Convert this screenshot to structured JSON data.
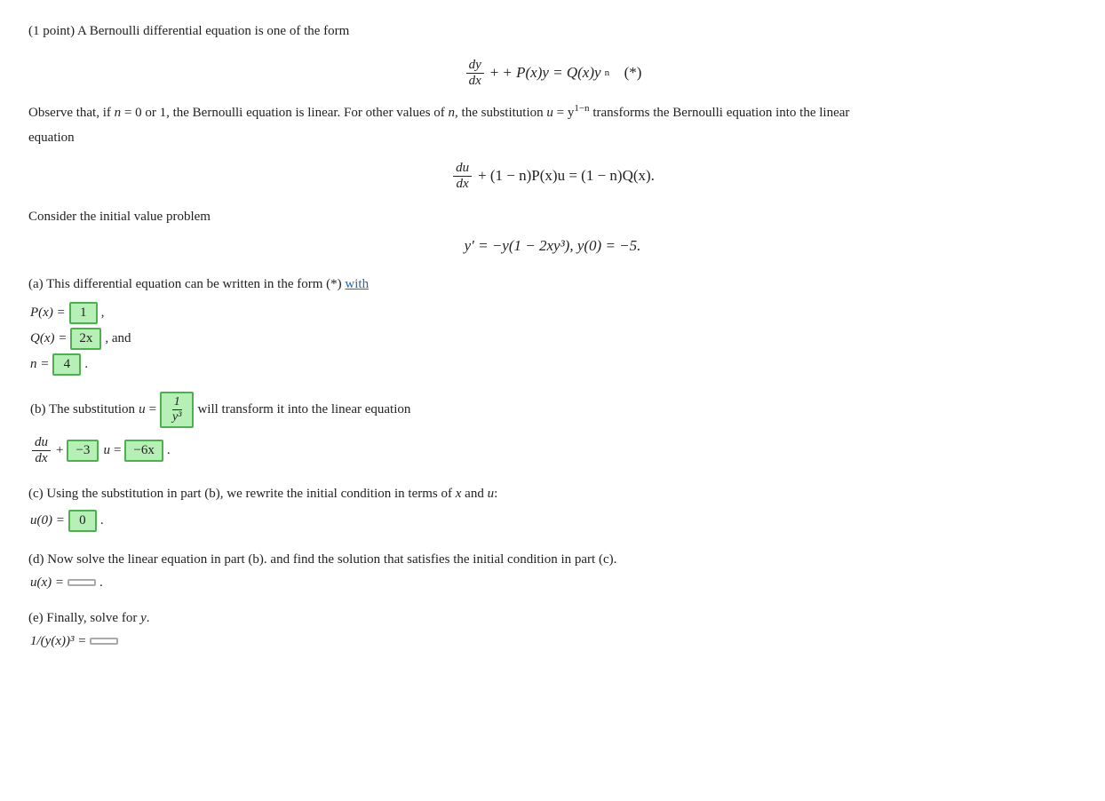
{
  "header": {
    "intro": "(1 point) A Bernoulli differential equation is one of the form"
  },
  "formula1": {
    "num": "dy",
    "den": "dx",
    "rest": "+ P(x)y = Q(x)y",
    "exp": "n",
    "star": "(*)"
  },
  "observe": {
    "text1": "Observe that, if ",
    "n": "n",
    "text2": " = 0 or 1, the Bernoulli equation is linear. For other values of ",
    "n2": "n",
    "text3": ", the substitution ",
    "u": "u",
    "text4": " = y",
    "exp": "1−n",
    "text5": " transforms the Bernoulli equation into the linear"
  },
  "observe2": "equation",
  "formula2": {
    "num": "du",
    "den": "dx",
    "rest": "+ (1 − n)P(x)u = (1 − n)Q(x)."
  },
  "consider": {
    "text": "Consider the initial value problem"
  },
  "formula3": {
    "eq": "y′ = −y(1 − 2xy³),   y(0) = −5."
  },
  "parta": {
    "label": "(a) This differential equation can be written in the form (*) ",
    "with": "with",
    "Px": "P(x) = ",
    "Px_val": "1",
    "comma1": ",",
    "Qx": "Q(x) = ",
    "Qx_val": "2x",
    "and": ", and",
    "n": "n = ",
    "n_val": "4"
  },
  "partb": {
    "label": "(b) The substitution ",
    "u": "u",
    "equals": " = ",
    "frac_num": "1",
    "frac_den": "y³",
    "rest": "will transform it into the linear equation",
    "du": "du",
    "dx": "dx",
    "plus": "+",
    "coeff1": "−3",
    "u_sym": "u",
    "equals2": " = ",
    "coeff2": "−6x",
    "period": "."
  },
  "partc": {
    "label": "(c) Using the substitution in part (b), we rewrite the initial condition in terms of ",
    "x": "x",
    "and": " and ",
    "u": "u",
    "colon": ":",
    "u0": "u(0) = ",
    "u0_val": "0",
    "period": "."
  },
  "partd": {
    "label1": "(d) Now solve the linear equation in part (b).",
    "label2": "and find the solution that satisfies the initial condition in part (c).",
    "ux": "u(x) = ",
    "ux_val": "",
    "period": "."
  },
  "parte": {
    "label": "(e) Finally, solve for ",
    "y": "y",
    "period": ".",
    "expr": "1/(y(x))³ = ",
    "val": ""
  }
}
